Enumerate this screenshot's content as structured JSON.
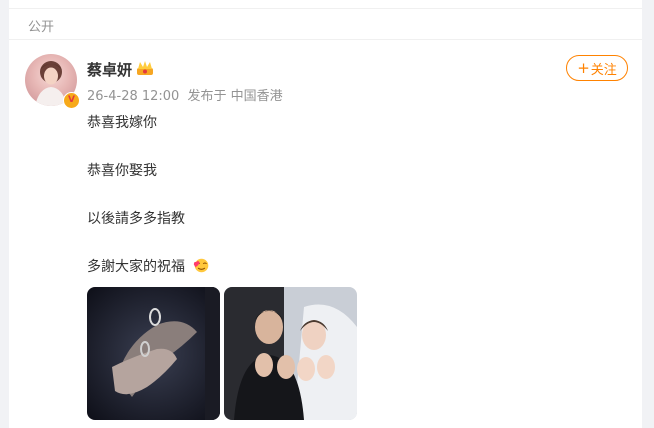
{
  "scope": {
    "label": "公开"
  },
  "post": {
    "username": "蔡卓妍",
    "username_badge_icon": "crown-icon",
    "verified_icon": "verified-v-icon",
    "timestamp": "26-4-28 12:00",
    "published_from": "发布于 中国香港",
    "follow_label": "关注",
    "lines": [
      "恭喜我嫁你",
      "恭喜你娶我",
      "以後請多多指教",
      "多謝大家的祝福"
    ],
    "emoji_icon": "hugging-heart-emoji-icon",
    "images": [
      {
        "name": "ring-hands-photo"
      },
      {
        "name": "couple-wedding-photo"
      }
    ]
  },
  "colors": {
    "accent": "#ff8200",
    "muted": "#939393",
    "text": "#333333",
    "background": "#f1f2f5"
  }
}
